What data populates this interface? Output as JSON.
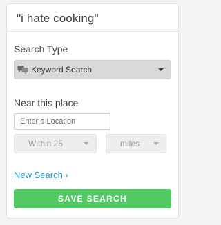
{
  "header": {
    "query": "\"i hate cooking\""
  },
  "search_type": {
    "label": "Search Type",
    "selected": "Keyword Search",
    "icon": "speech-bubbles-icon"
  },
  "location": {
    "label": "Near this place",
    "placeholder": "Enter a Location",
    "value": ""
  },
  "distance": {
    "selected": "Within 25"
  },
  "units": {
    "selected": "miles"
  },
  "actions": {
    "new_search_label": "New Search ›",
    "save_label": "SAVE SEARCH"
  },
  "colors": {
    "link": "#2299cc",
    "save_button": "#55c866"
  }
}
